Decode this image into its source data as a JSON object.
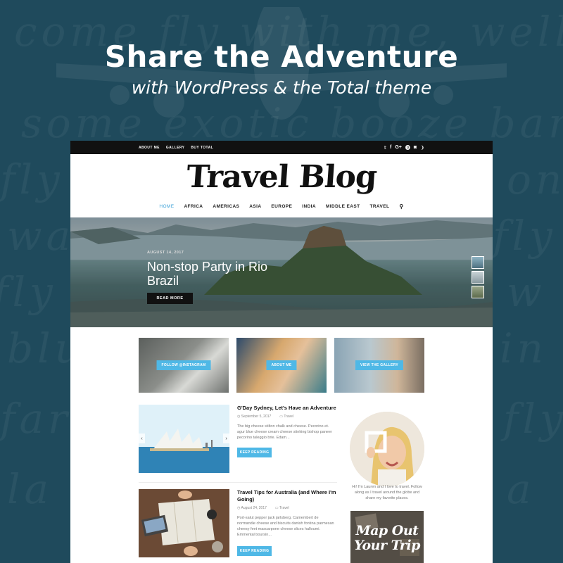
{
  "hero": {
    "title": "Share the Adventure",
    "subtitle": "with WordPress & the Total theme"
  },
  "topbar": {
    "links": [
      "ABOUT ME",
      "GALLERY",
      "BUY TOTAL"
    ],
    "social_icons": [
      "twitter-icon",
      "facebook-icon",
      "google-plus-icon",
      "pinterest-icon",
      "instagram-icon",
      "rss-icon"
    ]
  },
  "logo": "Travel Blog",
  "nav": {
    "items": [
      "HOME",
      "AFRICA",
      "AMERICAS",
      "ASIA",
      "EUROPE",
      "INDIA",
      "MIDDLE EAST",
      "TRAVEL"
    ],
    "active": "HOME"
  },
  "slider": {
    "date": "AUGUST 14, 2017",
    "title": "Non-stop Party in Rio Brazil",
    "button": "READ MORE"
  },
  "promos": [
    {
      "label": "FOLLOW @INSTAGRAM"
    },
    {
      "label": "ABOUT ME"
    },
    {
      "label": "VIEW THE GALLERY"
    }
  ],
  "posts": [
    {
      "title": "G'Day Sydney, Let's Have an Adventure",
      "date": "September 5, 2017",
      "category": "Travel",
      "excerpt": "The big cheese stilton chalk and cheese. Pecorino et. agur blue cheese cream cheese stinking bishop paneer pecorino taleggio brie. Edam...",
      "button": "KEEP READING"
    },
    {
      "title": "Travel Tips for Australia (and Where I'm Going)",
      "date": "August 24, 2017",
      "category": "Travel",
      "excerpt": "Port-salut pepper jack jarlsberg. Camembert de normandie cheese and biscuits danish fontina parmesan cheesy feet mascarpone cheese slices halloumi. Emmental boursin...",
      "button": "KEEP READING"
    }
  ],
  "sidebar": {
    "about": "Hi! I'm Lauren and I love to travel. Follow along as I travel around the globe and share my favorite places.",
    "map_card": [
      "Map Out",
      "Your Trip"
    ]
  },
  "colors": {
    "background": "#1f4a5c",
    "accent": "#4fb8e6",
    "topbar": "#111111"
  }
}
